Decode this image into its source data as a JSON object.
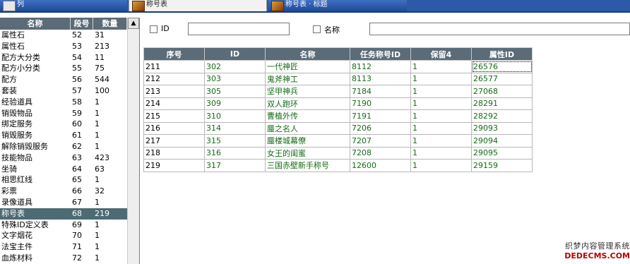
{
  "tabs": [
    {
      "label": "列",
      "active": false
    },
    {
      "label": "称号表",
      "active": true
    },
    {
      "label": "称号表 · 标题",
      "active": false
    }
  ],
  "left_list": {
    "columns": [
      "名称",
      "段号",
      "数量"
    ],
    "rows": [
      {
        "name": "属性石",
        "seg": "52",
        "qty": "31"
      },
      {
        "name": "属性石",
        "seg": "53",
        "qty": "213"
      },
      {
        "name": "配方大分类",
        "seg": "54",
        "qty": "11"
      },
      {
        "name": "配方小分类",
        "seg": "55",
        "qty": "75"
      },
      {
        "name": "配方",
        "seg": "56",
        "qty": "544"
      },
      {
        "name": "套装",
        "seg": "57",
        "qty": "100"
      },
      {
        "name": "经验道具",
        "seg": "58",
        "qty": "1"
      },
      {
        "name": "销毁物品",
        "seg": "59",
        "qty": "1"
      },
      {
        "name": "绑定服务",
        "seg": "60",
        "qty": "1"
      },
      {
        "name": "销毁服务",
        "seg": "61",
        "qty": "1"
      },
      {
        "name": "解除销毁服务",
        "seg": "62",
        "qty": "1"
      },
      {
        "name": "技能物品",
        "seg": "63",
        "qty": "423"
      },
      {
        "name": "坐骑",
        "seg": "64",
        "qty": "63"
      },
      {
        "name": "相思红线",
        "seg": "65",
        "qty": "1"
      },
      {
        "name": "彩票",
        "seg": "66",
        "qty": "32"
      },
      {
        "name": "录像道具",
        "seg": "67",
        "qty": "1"
      },
      {
        "name": "称号表",
        "seg": "68",
        "qty": "219",
        "selected": true
      },
      {
        "name": "特殊ID定义表",
        "seg": "69",
        "qty": "1"
      },
      {
        "name": "文字烟花",
        "seg": "70",
        "qty": "1"
      },
      {
        "name": "法宝主件",
        "seg": "71",
        "qty": "1"
      },
      {
        "name": "血炼材料",
        "seg": "72",
        "qty": "1"
      }
    ]
  },
  "filter": {
    "id_label": "ID",
    "name_label": "名称",
    "id_value": "",
    "name_value": ""
  },
  "grid": {
    "columns": [
      "序号",
      "ID",
      "名称",
      "任务称号ID",
      "保留4",
      "属性ID"
    ],
    "rows": [
      [
        "211",
        "302",
        "一代神匠",
        "8112",
        "1",
        "26576"
      ],
      [
        "212",
        "303",
        "鬼斧神工",
        "8113",
        "1",
        "26577"
      ],
      [
        "213",
        "305",
        "坚甲神兵",
        "7184",
        "1",
        "27068"
      ],
      [
        "214",
        "309",
        "双人跑环",
        "7190",
        "1",
        "28291"
      ],
      [
        "215",
        "310",
        "曹植外传",
        "7191",
        "1",
        "28292"
      ],
      [
        "216",
        "314",
        "蜃之名人",
        "7206",
        "1",
        "29093"
      ],
      [
        "217",
        "315",
        "蜃楼城幕僚",
        "7207",
        "1",
        "29094"
      ],
      [
        "218",
        "316",
        "女王的闺蜜",
        "7208",
        "1",
        "29095"
      ],
      [
        "219",
        "317",
        "三国赤壁新手称号",
        "12600",
        "1",
        "29159"
      ]
    ]
  },
  "watermark": {
    "line1": "织梦内容管理系统",
    "line2": "DEDECMS.COM"
  },
  "colors": {
    "header_bg": "#5b6b78",
    "selected_row": "#4d6b73",
    "cell_text": "#156b16",
    "topbar": "#2c5aa8"
  },
  "icons": {
    "tab_icon": "game-icon",
    "scroll_up": "scroll-up-arrow-icon"
  }
}
